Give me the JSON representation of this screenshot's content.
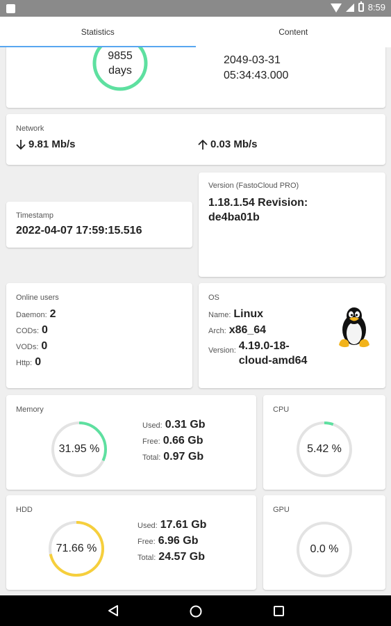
{
  "status_bar": {
    "time": "8:59"
  },
  "tabs": [
    {
      "label": "Statistics",
      "active": true
    },
    {
      "label": "Content",
      "active": false
    }
  ],
  "uptime": {
    "value": "9855",
    "unit": "days",
    "expires_line1": "2049-03-31",
    "expires_line2": "05:34:43.000"
  },
  "network": {
    "title": "Network",
    "down": "9.81 Mb/s",
    "up": "0.03 Mb/s",
    "down_icon": "arrow-down-icon",
    "up_icon": "arrow-up-icon"
  },
  "timestamp": {
    "title": "Timestamp",
    "value": "2022-04-07 17:59:15.516"
  },
  "version": {
    "title": "Version (FastoCloud PRO)",
    "line1": "1.18.1.54 Revision:",
    "line2": "de4ba01b"
  },
  "online_users": {
    "title": "Online users",
    "items": [
      {
        "label": "Daemon:",
        "value": "2"
      },
      {
        "label": "CODs:",
        "value": "0"
      },
      {
        "label": "VODs:",
        "value": "0"
      },
      {
        "label": "Http:",
        "value": "0"
      }
    ]
  },
  "os": {
    "title": "OS",
    "name_label": "Name:",
    "name": "Linux",
    "arch_label": "Arch:",
    "arch": "x86_64",
    "version_label": "Version:",
    "version_line1": "4.19.0-18-",
    "version_line2": "cloud-amd64",
    "icon": "tux-icon"
  },
  "memory": {
    "title": "Memory",
    "percent_text": "31.95 %",
    "fraction": 0.3195,
    "used_label": "Used:",
    "used": "0.31 Gb",
    "free_label": "Free:",
    "free": "0.66 Gb",
    "total_label": "Total:",
    "total": "0.97 Gb"
  },
  "cpu": {
    "title": "CPU",
    "percent_text": "5.42 %",
    "fraction": 0.0542
  },
  "hdd": {
    "title": "HDD",
    "percent_text": "71.66 %",
    "fraction": 0.7166,
    "used_label": "Used:",
    "used": "17.61 Gb",
    "free_label": "Free:",
    "free": "6.96 Gb",
    "total_label": "Total:",
    "total": "24.57 Gb"
  },
  "gpu": {
    "title": "GPU",
    "percent_text": "0.0 %",
    "fraction": 0
  },
  "colors": {
    "green": "#5ee0a0",
    "yellow": "#f6cf3c",
    "track": "#e3e3e3",
    "tab_indicator": "#58a6f0"
  }
}
